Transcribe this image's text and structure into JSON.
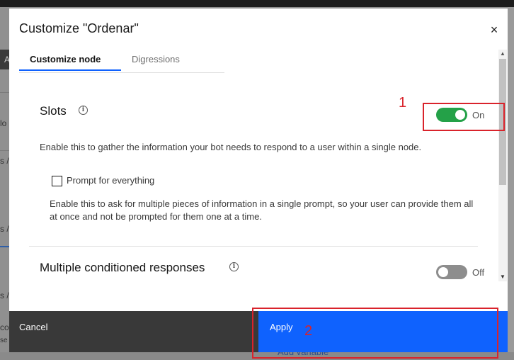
{
  "modal": {
    "title": "Customize \"Ordenar\"",
    "close": "×"
  },
  "tabs": [
    {
      "label": "Customize node",
      "active": true
    },
    {
      "label": "Digressions",
      "active": false
    }
  ],
  "slots": {
    "title": "Slots",
    "info": "i",
    "toggle_state": "On",
    "toggle_on": true,
    "description": "Enable this to gather the information your bot needs to respond to a user within a single node.",
    "prompt_label": "Prompt for everything",
    "prompt_checked": false,
    "prompt_description": "Enable this to ask for multiple pieces of information in a single prompt, so your user can provide them all at once and not be prompted for them one at a time."
  },
  "multiple": {
    "title": "Multiple conditioned responses",
    "info": "i",
    "toggle_state": "Off",
    "toggle_on": false
  },
  "footer": {
    "cancel": "Cancel",
    "apply": "Apply"
  },
  "annotations": {
    "one": "1",
    "two": "2"
  },
  "background": {
    "left_text_a": "A",
    "left_text_b": "lo",
    "left_text_c": "s /",
    "left_text_d": "s /",
    "left_text_e": "s /",
    "left_text_f": "co",
    "left_text_g": "se",
    "add_variable": "Add variable"
  },
  "colors": {
    "primary": "#0f62fe",
    "toggle_on": "#24a148",
    "toggle_off": "#8d8d8d",
    "annotation": "#d9232b",
    "cancel_bg": "#393939"
  },
  "icons": [
    "close-icon",
    "info-icon",
    "scroll-up-icon",
    "scroll-down-icon"
  ]
}
